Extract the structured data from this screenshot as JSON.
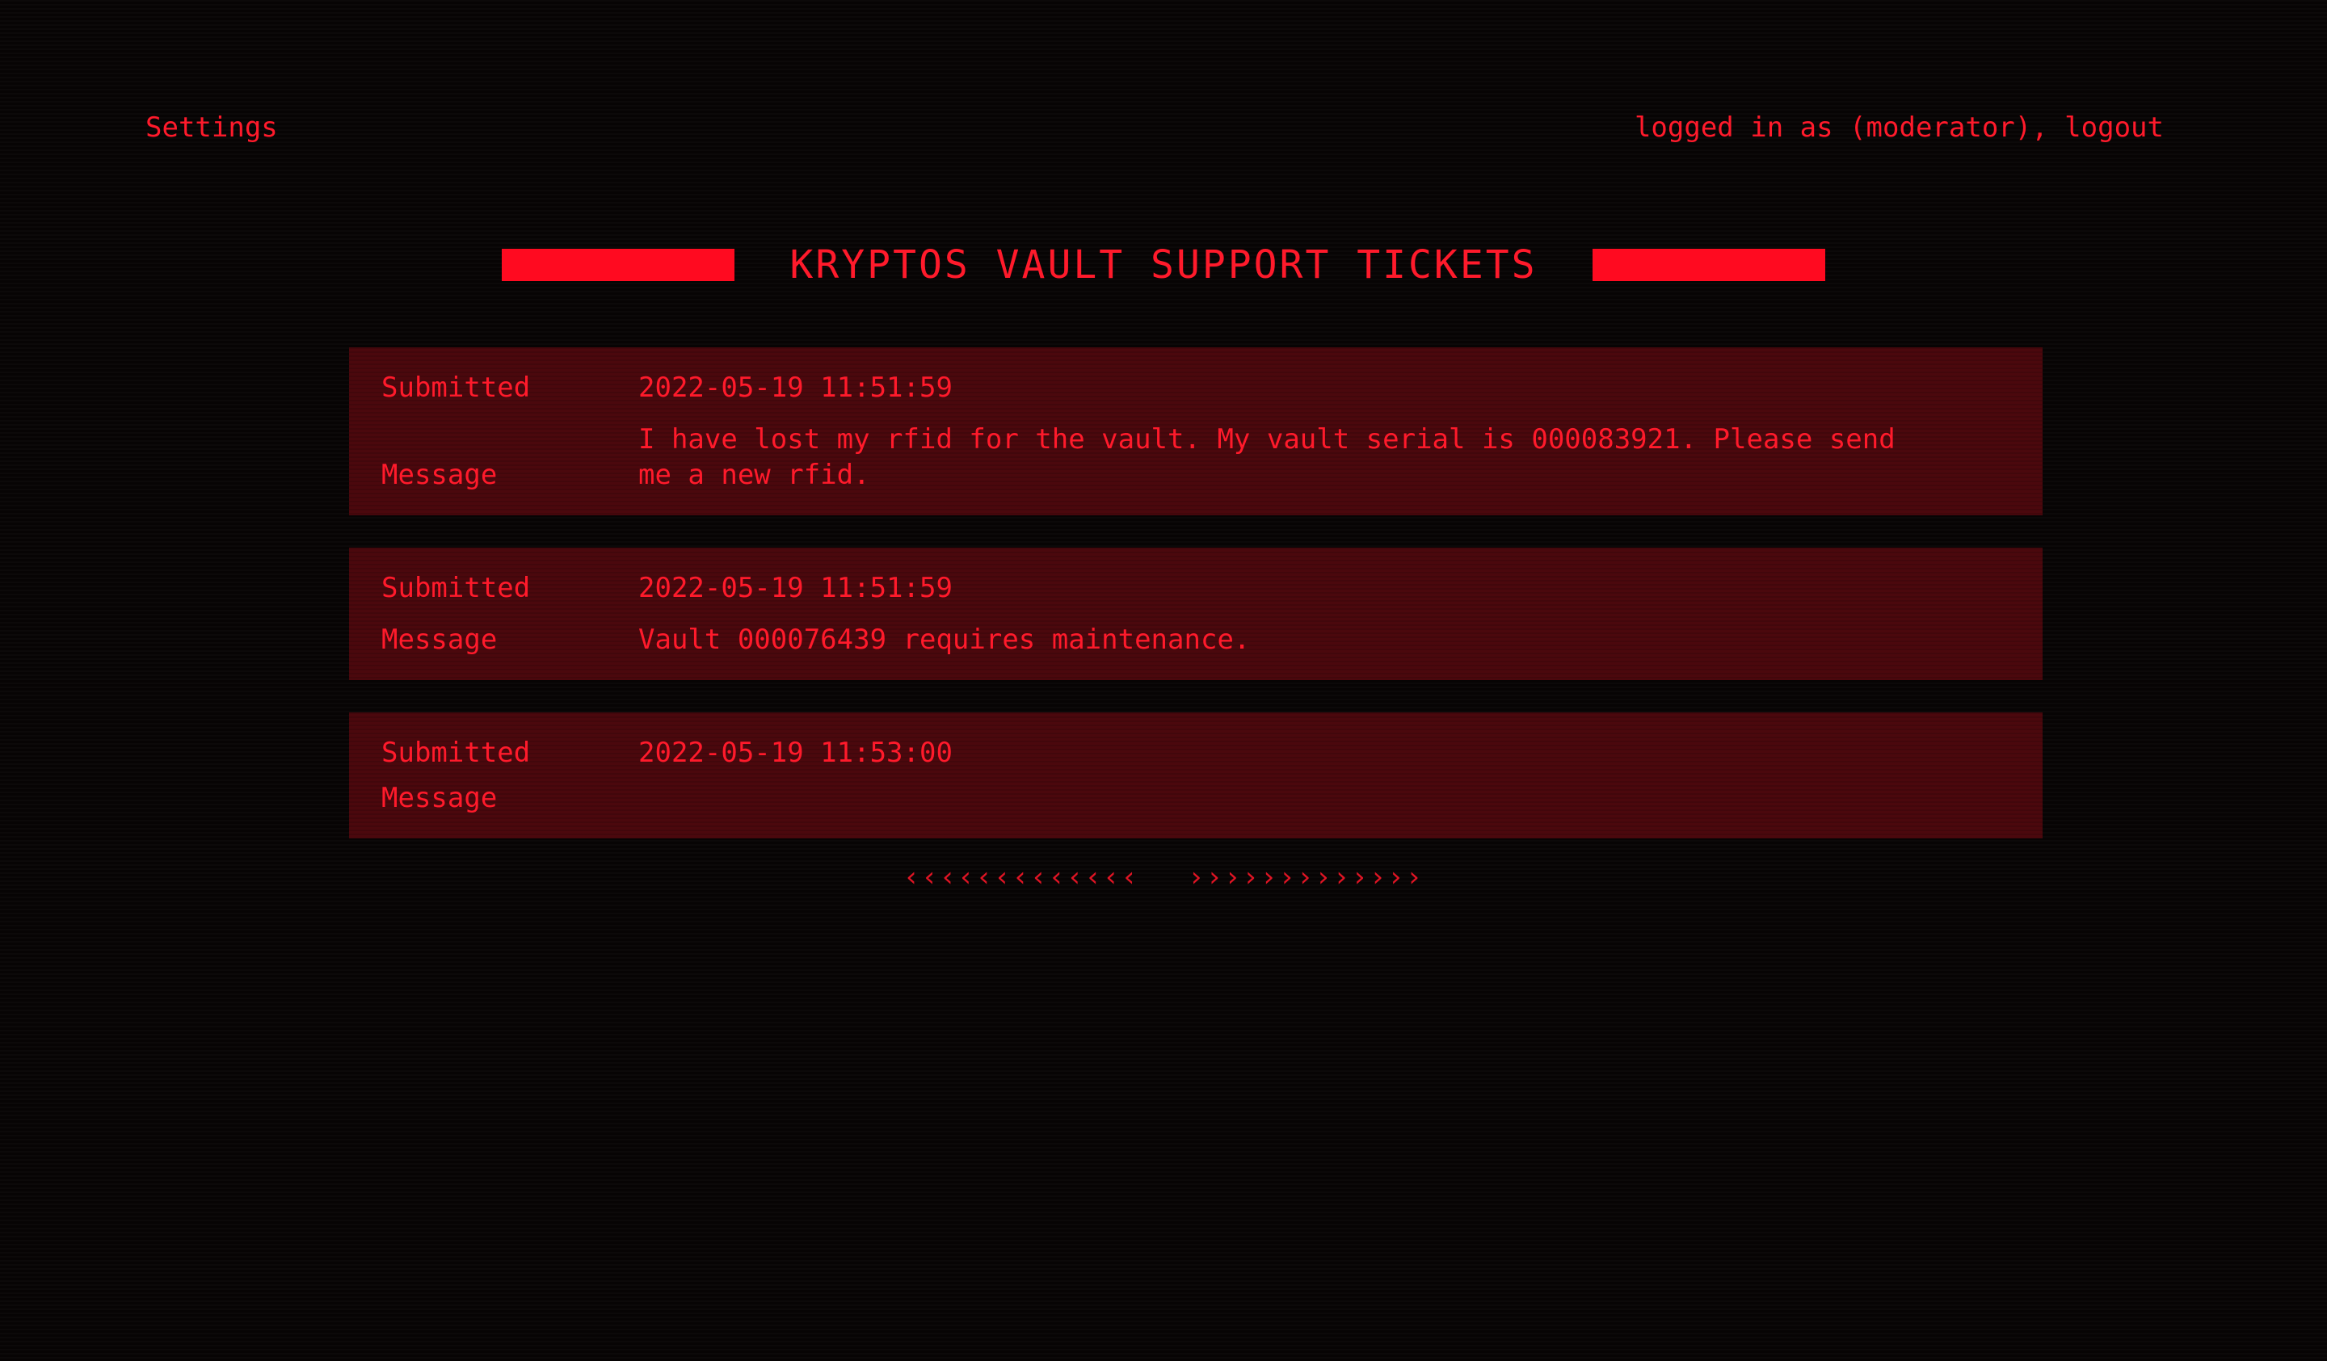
{
  "header": {
    "settings_label": "Settings",
    "session_prefix": "logged in as (moderator), ",
    "logout_label": "logout"
  },
  "page": {
    "title": "KRYPTOS VAULT SUPPORT TICKETS"
  },
  "ticket_labels": {
    "submitted": "Submitted",
    "message": "Message"
  },
  "tickets": [
    {
      "submitted": "2022-05-19 11:51:59",
      "message": "I have lost my rfid for the vault. My vault serial is 000083921. Please send me a new rfid."
    },
    {
      "submitted": "2022-05-19 11:51:59",
      "message": "Vault 000076439 requires maintenance."
    },
    {
      "submitted": "2022-05-19 11:53:00",
      "message": ""
    }
  ],
  "pager": {
    "prev_label": "‹‹‹‹‹‹‹‹‹‹‹‹‹",
    "next_label": "›››››››››››››"
  },
  "colors": {
    "accent": "#ff1a2b",
    "background": "#070404",
    "panel": "#4b080d",
    "title_bar": "#ff0a20"
  }
}
